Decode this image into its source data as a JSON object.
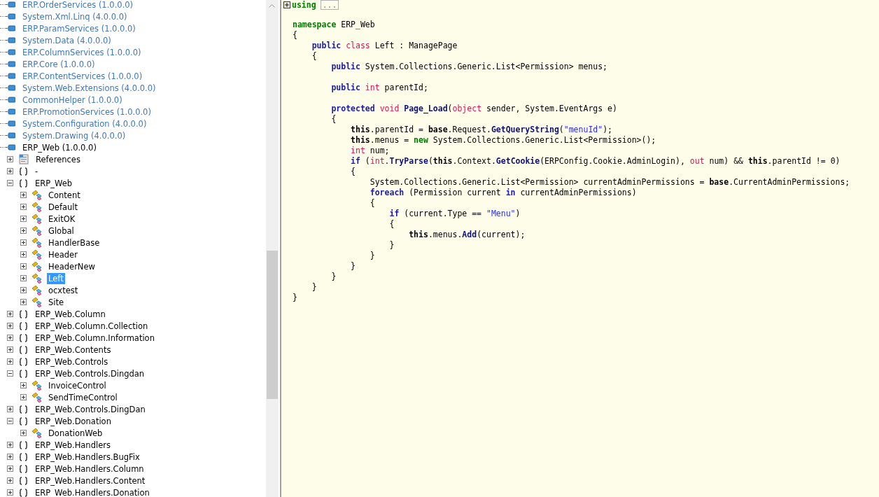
{
  "tree": [
    {
      "label": "ERP.OrderServices (1.0.0.0)",
      "kind": "assembly",
      "dimmed": true,
      "selected": false
    },
    {
      "label": "System.Xml.Linq (4.0.0.0)",
      "kind": "assembly",
      "dimmed": true,
      "selected": false
    },
    {
      "label": "ERP.ParamServices (1.0.0.0)",
      "kind": "assembly",
      "dimmed": true,
      "selected": false
    },
    {
      "label": "System.Data (4.0.0.0)",
      "kind": "assembly",
      "dimmed": true,
      "selected": false
    },
    {
      "label": "ERP.ColumnServices (1.0.0.0)",
      "kind": "assembly",
      "dimmed": true,
      "selected": false
    },
    {
      "label": "ERP.Core (1.0.0.0)",
      "kind": "assembly",
      "dimmed": true,
      "selected": false
    },
    {
      "label": "ERP.ContentServices (1.0.0.0)",
      "kind": "assembly",
      "dimmed": true,
      "selected": false
    },
    {
      "label": "System.Web.Extensions (4.0.0.0)",
      "kind": "assembly",
      "dimmed": true,
      "selected": false
    },
    {
      "label": "CommonHelper (1.0.0.0)",
      "kind": "assembly",
      "dimmed": true,
      "selected": false
    },
    {
      "label": "ERP.PromotionServices (1.0.0.0)",
      "kind": "assembly",
      "dimmed": true,
      "selected": false
    },
    {
      "label": "System.Configuration (4.0.0.0)",
      "kind": "assembly",
      "dimmed": true,
      "selected": false
    },
    {
      "label": "System.Drawing (4.0.0.0)",
      "kind": "assembly",
      "dimmed": true,
      "selected": false
    },
    {
      "label": "ERP_Web (1.0.0.0)",
      "kind": "assembly",
      "dimmed": false,
      "selected": false,
      "children": [
        {
          "label": "References",
          "kind": "references",
          "expanded": false,
          "selected": false
        },
        {
          "label": "-",
          "kind": "namespace",
          "expanded": false,
          "selected": false
        },
        {
          "label": "ERP_Web",
          "kind": "namespace",
          "expanded": true,
          "selected": false,
          "children": [
            {
              "label": "Content",
              "kind": "class",
              "expanded": false,
              "selected": false
            },
            {
              "label": "Default",
              "kind": "class",
              "expanded": false,
              "selected": false
            },
            {
              "label": "ExitOK",
              "kind": "class",
              "expanded": false,
              "selected": false
            },
            {
              "label": "Global",
              "kind": "class",
              "expanded": false,
              "selected": false
            },
            {
              "label": "HandlerBase",
              "kind": "class",
              "expanded": false,
              "selected": false
            },
            {
              "label": "Header",
              "kind": "class",
              "expanded": false,
              "selected": false
            },
            {
              "label": "HeaderNew",
              "kind": "class",
              "expanded": false,
              "selected": false
            },
            {
              "label": "Left",
              "kind": "class",
              "expanded": false,
              "selected": true
            },
            {
              "label": "ocxtest",
              "kind": "class",
              "expanded": false,
              "selected": false
            },
            {
              "label": "Site",
              "kind": "class",
              "expanded": false,
              "selected": false
            }
          ]
        },
        {
          "label": "ERP_Web.Column",
          "kind": "namespace",
          "expanded": false,
          "selected": false
        },
        {
          "label": "ERP_Web.Column.Collection",
          "kind": "namespace",
          "expanded": false,
          "selected": false
        },
        {
          "label": "ERP_Web.Column.Information",
          "kind": "namespace",
          "expanded": false,
          "selected": false
        },
        {
          "label": "ERP_Web.Contents",
          "kind": "namespace",
          "expanded": false,
          "selected": false
        },
        {
          "label": "ERP_Web.Controls",
          "kind": "namespace",
          "expanded": false,
          "selected": false
        },
        {
          "label": "ERP_Web.Controls.Dingdan",
          "kind": "namespace",
          "expanded": true,
          "selected": false,
          "children": [
            {
              "label": "InvoiceControl",
              "kind": "class",
              "expanded": false,
              "selected": false
            },
            {
              "label": "SendTimeControl",
              "kind": "class",
              "expanded": false,
              "selected": false
            }
          ]
        },
        {
          "label": "ERP_Web.Controls.DingDan",
          "kind": "namespace",
          "expanded": false,
          "selected": false
        },
        {
          "label": "ERP_Web.Donation",
          "kind": "namespace",
          "expanded": true,
          "selected": false,
          "children": [
            {
              "label": "DonationWeb",
              "kind": "class",
              "expanded": false,
              "selected": false
            }
          ]
        },
        {
          "label": "ERP_Web.Handlers",
          "kind": "namespace",
          "expanded": false,
          "selected": false
        },
        {
          "label": "ERP_Web.Handlers.BugFix",
          "kind": "namespace",
          "expanded": false,
          "selected": false
        },
        {
          "label": "ERP_Web.Handlers.Column",
          "kind": "namespace",
          "expanded": false,
          "selected": false
        },
        {
          "label": "ERP_Web.Handlers.Content",
          "kind": "namespace",
          "expanded": false,
          "selected": false
        },
        {
          "label": "ERP_Web.Handlers.Donation",
          "kind": "namespace",
          "expanded": false,
          "selected": false
        }
      ]
    }
  ],
  "using_region": {
    "keyword": "using",
    "collapsed_text": "...",
    "expanded": false
  },
  "code": [
    {
      "blank_before": true,
      "tokens": [
        {
          "text": "namespace",
          "kind": "ns"
        },
        {
          "text": " ERP_Web",
          "kind": "plain"
        }
      ]
    },
    {
      "tokens": [
        {
          "text": "{",
          "kind": "plain"
        }
      ]
    },
    {
      "tokens": [
        {
          "text": "    public",
          "kind": "kw"
        },
        {
          "text": " class",
          "kind": "type"
        },
        {
          "text": " Left : ManagePage",
          "kind": "plain"
        }
      ]
    },
    {
      "tokens": [
        {
          "text": "    {",
          "kind": "plain"
        }
      ]
    },
    {
      "tokens": [
        {
          "text": "        public",
          "kind": "kw"
        },
        {
          "text": " System.Collections.Generic.List<Permission> menus;",
          "kind": "plain"
        }
      ]
    },
    {
      "blank_before": true,
      "tokens": [
        {
          "text": "        public",
          "kind": "kw"
        },
        {
          "text": " int",
          "kind": "type"
        },
        {
          "text": " parentId;",
          "kind": "plain"
        }
      ]
    },
    {
      "blank_before": true,
      "tokens": [
        {
          "text": "        protected",
          "kind": "kw"
        },
        {
          "text": " void",
          "kind": "type"
        },
        {
          "text": " Page_Load",
          "kind": "method"
        },
        {
          "text": "(",
          "kind": "plain"
        },
        {
          "text": "object",
          "kind": "type"
        },
        {
          "text": " sender, System.EventArgs e)",
          "kind": "plain"
        }
      ]
    },
    {
      "tokens": [
        {
          "text": "        {",
          "kind": "plain"
        }
      ]
    },
    {
      "tokens": [
        {
          "text": "            this",
          "kind": "bold"
        },
        {
          "text": ".parentId = ",
          "kind": "plain"
        },
        {
          "text": "base",
          "kind": "bold"
        },
        {
          "text": ".Request.",
          "kind": "plain"
        },
        {
          "text": "GetQueryString",
          "kind": "method"
        },
        {
          "text": "(",
          "kind": "plain"
        },
        {
          "text": "\"menuId\"",
          "kind": "str"
        },
        {
          "text": ");",
          "kind": "plain"
        }
      ]
    },
    {
      "tokens": [
        {
          "text": "            this",
          "kind": "bold"
        },
        {
          "text": ".menus = ",
          "kind": "plain"
        },
        {
          "text": "new",
          "kind": "ns"
        },
        {
          "text": " System.Collections.Generic.List<Permission>();",
          "kind": "plain"
        }
      ]
    },
    {
      "tokens": [
        {
          "text": "            int",
          "kind": "type"
        },
        {
          "text": " num;",
          "kind": "plain"
        }
      ]
    },
    {
      "tokens": [
        {
          "text": "            if",
          "kind": "kw"
        },
        {
          "text": " (",
          "kind": "plain"
        },
        {
          "text": "int",
          "kind": "type"
        },
        {
          "text": ".",
          "kind": "plain"
        },
        {
          "text": "TryParse",
          "kind": "method"
        },
        {
          "text": "(",
          "kind": "plain"
        },
        {
          "text": "this",
          "kind": "bold"
        },
        {
          "text": ".Context.",
          "kind": "plain"
        },
        {
          "text": "GetCookie",
          "kind": "method"
        },
        {
          "text": "(ERPConfig.Cookie.AdminLogin), ",
          "kind": "plain"
        },
        {
          "text": "out",
          "kind": "type"
        },
        {
          "text": " num) && ",
          "kind": "plain"
        },
        {
          "text": "this",
          "kind": "bold"
        },
        {
          "text": ".parentId != ",
          "kind": "plain"
        },
        {
          "text": "0",
          "kind": "num"
        },
        {
          "text": ")",
          "kind": "plain"
        }
      ]
    },
    {
      "tokens": [
        {
          "text": "            {",
          "kind": "plain"
        }
      ]
    },
    {
      "tokens": [
        {
          "text": "                System.Collections.Generic.List<Permission> currentAdminPermissions = ",
          "kind": "plain"
        },
        {
          "text": "base",
          "kind": "bold"
        },
        {
          "text": ".CurrentAdminPermissions;",
          "kind": "plain"
        }
      ]
    },
    {
      "tokens": [
        {
          "text": "                foreach",
          "kind": "kw"
        },
        {
          "text": " (Permission current ",
          "kind": "plain"
        },
        {
          "text": "in",
          "kind": "kw"
        },
        {
          "text": " currentAdminPermissions)",
          "kind": "plain"
        }
      ]
    },
    {
      "tokens": [
        {
          "text": "                {",
          "kind": "plain"
        }
      ]
    },
    {
      "tokens": [
        {
          "text": "                    if",
          "kind": "kw"
        },
        {
          "text": " (current.Type == ",
          "kind": "plain"
        },
        {
          "text": "\"Menu\"",
          "kind": "str"
        },
        {
          "text": ")",
          "kind": "plain"
        }
      ]
    },
    {
      "tokens": [
        {
          "text": "                    {",
          "kind": "plain"
        }
      ]
    },
    {
      "tokens": [
        {
          "text": "                        this",
          "kind": "bold"
        },
        {
          "text": ".menus.",
          "kind": "plain"
        },
        {
          "text": "Add",
          "kind": "method"
        },
        {
          "text": "(current);",
          "kind": "plain"
        }
      ]
    },
    {
      "tokens": [
        {
          "text": "                    }",
          "kind": "plain"
        }
      ]
    },
    {
      "tokens": [
        {
          "text": "                }",
          "kind": "plain"
        }
      ]
    },
    {
      "tokens": [
        {
          "text": "            }",
          "kind": "plain"
        }
      ]
    },
    {
      "tokens": [
        {
          "text": "        }",
          "kind": "plain"
        }
      ]
    },
    {
      "tokens": [
        {
          "text": "    }",
          "kind": "plain"
        }
      ]
    },
    {
      "tokens": [
        {
          "text": "}",
          "kind": "plain"
        }
      ]
    }
  ]
}
